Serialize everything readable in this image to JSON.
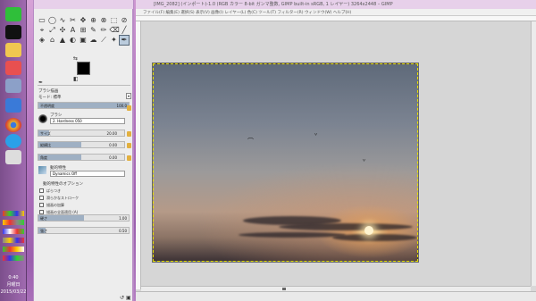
{
  "taskbar": {
    "apps": [
      {
        "name": "line-app-icon",
        "color": "#2fbf3a"
      },
      {
        "name": "black-app-icon",
        "color": "#111111"
      },
      {
        "name": "folder-app-icon",
        "color": "#f0c850"
      },
      {
        "name": "settings-app-icon",
        "color": "#8ca0c8"
      },
      {
        "name": "stretch-app-icon",
        "color": "#3a7ad8"
      },
      {
        "name": "chrome-app-icon",
        "color": "#e6b030"
      },
      {
        "name": "skype-app-icon",
        "color": "#2aa0e8"
      },
      {
        "name": "document-app-icon",
        "color": "#dddddd"
      }
    ],
    "clock_time": "0:40",
    "clock_day": "月曜日",
    "clock_date": "2015/03/22"
  },
  "toolbox": {
    "tools": [
      "▭",
      "◯",
      "∿",
      "✂",
      "✥",
      "⊕",
      "⊗",
      "⬚",
      "⊘",
      "⌖",
      "⤢",
      "✣",
      "A",
      "⊞",
      "✎",
      "✏",
      "⌫",
      "╱",
      "◈",
      "⌂",
      "▲",
      "◐",
      "▣",
      "☁",
      "⟋",
      "✦",
      "✒"
    ],
    "options_title": "ブラシ描画",
    "mode_label": "モード: 標準",
    "opacity_label": "不透明度",
    "opacity_value": "100.0",
    "brush_label": "ブラシ",
    "brush_name": "2. Hardness 050",
    "size_label": "サイズ",
    "size_value": "20.00",
    "aspect_label": "縦横比",
    "aspect_value": "0.00",
    "angle_label": "角度",
    "angle_value": "0.00",
    "dynamics_label": "動的特性",
    "dynamics_name": "Dynamics Off",
    "dynamics_options": "動的特性のオプション",
    "jitter_label": "ばらつき",
    "smooth_label": "滑らかなストローク",
    "incremental_label": "描画の加算",
    "apply_label": "描画の全面適用 (A)",
    "hardness_label": "硬さ",
    "hardness_value": "1.00",
    "force_label": "強さ",
    "force_value": "0.50"
  },
  "image_window": {
    "title": "[IMG_2082] (インポート)-1.0 (RGB カラー 8-bit ガンマ整数, GIMP built-in sRGB, 1 レイヤー) 3264x2448 – GIMP",
    "menu": "ファイル(F) 編集(E) 選択(S) 表示(V) 画像(I) レイヤー(L) 色(C) ツール(T) フィルター(R) ウィンドウ(W) ヘルプ(H)"
  }
}
